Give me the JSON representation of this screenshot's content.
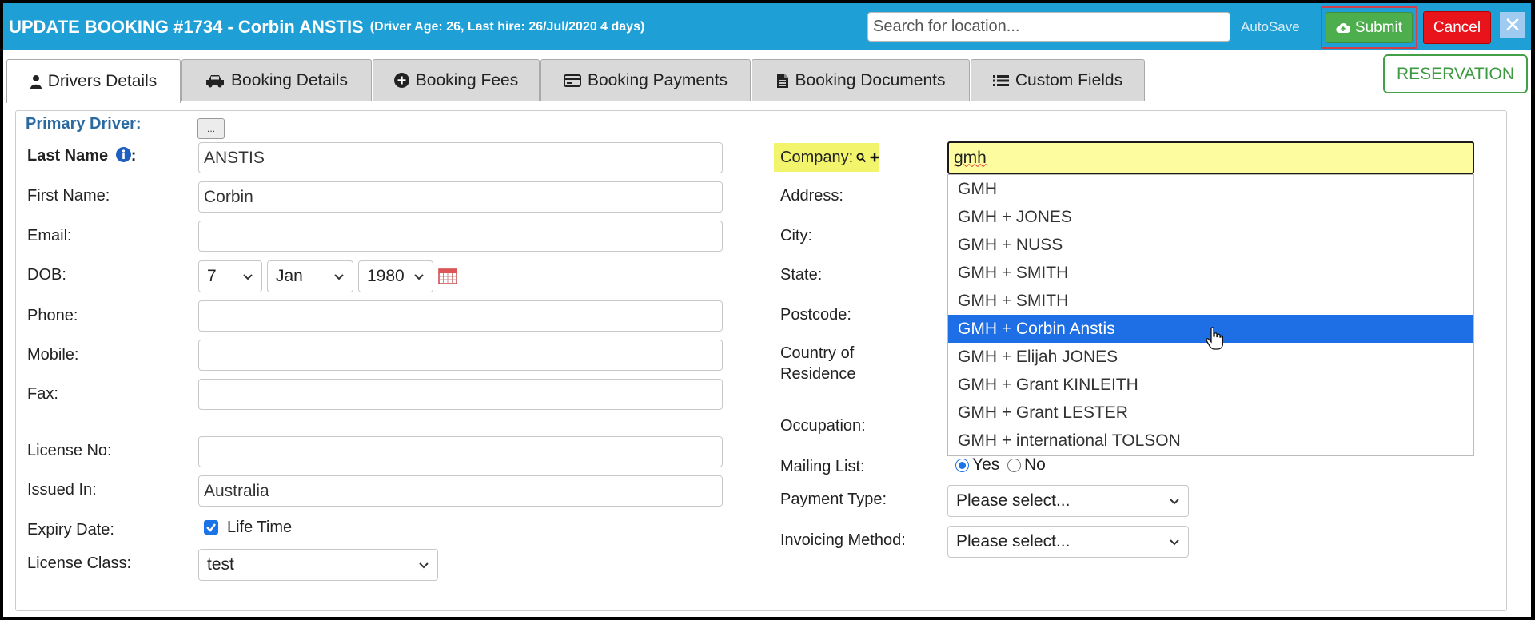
{
  "header": {
    "title": "UPDATE BOOKING #1734  - Corbin ANSTIS",
    "subtitle": "(Driver Age: 26, Last hire: 26/Jul/2020 4 days)",
    "search_placeholder": "Search for location...",
    "autosave": "AutoSave",
    "submit": "Submit",
    "cancel": "Cancel",
    "close": "✕"
  },
  "tabs": [
    {
      "label": "Drivers Details",
      "icon": "user-icon"
    },
    {
      "label": "Booking Details",
      "icon": "car-icon"
    },
    {
      "label": "Booking Fees",
      "icon": "plus-circle-icon"
    },
    {
      "label": "Booking Payments",
      "icon": "credit-card-icon"
    },
    {
      "label": "Booking Documents",
      "icon": "file-icon"
    },
    {
      "label": "Custom Fields",
      "icon": "list-icon"
    }
  ],
  "status_badge": "RESERVATION",
  "primary_driver": {
    "label": "Primary Driver:",
    "button": "..."
  },
  "left_form": {
    "last_name": {
      "label": "Last Name",
      "value": "ANSTIS"
    },
    "first_name": {
      "label": "First Name:",
      "value": "Corbin"
    },
    "email": {
      "label": "Email:",
      "value": ""
    },
    "dob": {
      "label": "DOB:",
      "day": "7",
      "month": "Jan",
      "year": "1980"
    },
    "phone": {
      "label": "Phone:",
      "value": ""
    },
    "mobile": {
      "label": "Mobile:",
      "value": ""
    },
    "fax": {
      "label": "Fax:",
      "value": ""
    },
    "license_no": {
      "label": "License No:",
      "value": ""
    },
    "issued_in": {
      "label": "Issued In:",
      "value": "Australia"
    },
    "expiry_date": {
      "label": "Expiry Date:",
      "checkbox_label": "Life Time",
      "checked": true
    },
    "license_class": {
      "label": "License Class:",
      "value": "test"
    }
  },
  "right_form": {
    "company": {
      "label": "Company:",
      "value": "gmh"
    },
    "address": {
      "label": "Address:"
    },
    "city": {
      "label": "City:"
    },
    "state": {
      "label": "State:"
    },
    "postcode": {
      "label": "Postcode:"
    },
    "country_line1": "Country of",
    "country_line2": "Residence",
    "occupation": {
      "label": "Occupation:"
    },
    "mailing_list": {
      "label": "Mailing List:",
      "yes": "Yes",
      "no": "No",
      "selected": "Yes"
    },
    "payment_type": {
      "label": "Payment Type:",
      "value": "Please select..."
    },
    "invoicing_method": {
      "label": "Invoicing Method:",
      "value": "Please select..."
    }
  },
  "company_suggestions": [
    "GMH",
    "GMH + JONES",
    "GMH + NUSS",
    "GMH + SMITH",
    "GMH + SMITH",
    "GMH + Corbin Anstis",
    "GMH + Elijah JONES",
    "GMH + Grant KINLEITH",
    "GMH + Grant LESTER",
    "GMH + international TOLSON"
  ],
  "selected_suggestion_index": 5,
  "colors": {
    "header_bg": "#1e9fd6",
    "submit_bg": "#4cae4c",
    "cancel_bg": "#e8131b",
    "selected_option": "#1e6fe6",
    "company_highlight": "#f2f56b"
  }
}
